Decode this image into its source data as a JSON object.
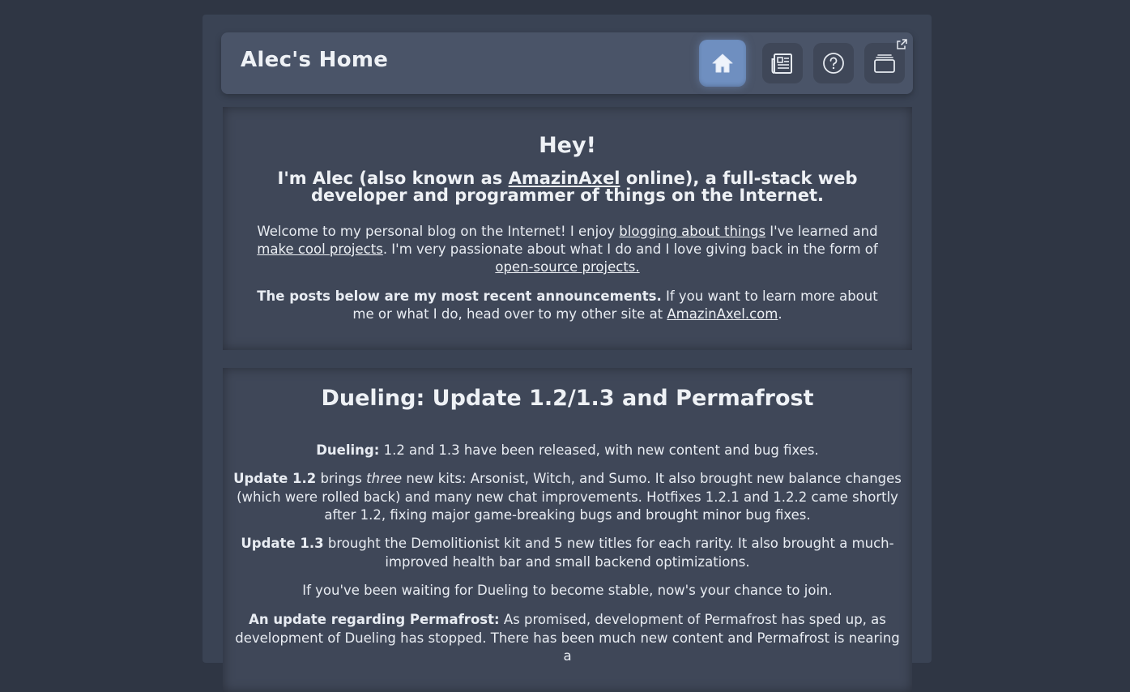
{
  "header": {
    "title": "Alec's Home",
    "nav": [
      {
        "icon": "home-icon",
        "active": true
      },
      {
        "icon": "newspaper-icon",
        "active": false
      },
      {
        "icon": "help-icon",
        "active": false
      },
      {
        "icon": "cards-external-icon",
        "active": false
      }
    ]
  },
  "intro": {
    "heading": "Hey!",
    "tagline_pre": "I'm Alec (also known as ",
    "tagline_link": "AmazinAxel",
    "tagline_post": " online), a full-stack web developer and programmer of things on the Internet.",
    "p1_a": "Welcome to my personal blog on the Internet! I enjoy ",
    "p1_link1": "blogging about things",
    "p1_b": " I've learned and ",
    "p1_link2": "make cool projects",
    "p1_c": ". I'm very passionate about what I do and I love giving back in the form of ",
    "p1_link3": "open-source projects.",
    "p2_bold": "The posts below are my most recent announcements.",
    "p2_a": " If you want to learn more about me or what I do, head over to my other site at ",
    "p2_link": "AmazinAxel.com",
    "p2_b": "."
  },
  "post": {
    "title": "Dueling: Update 1.2/1.3 and Permafrost",
    "s1_bold": "Dueling:",
    "s1_text": " 1.2 and 1.3 have been released, with new content and bug fixes.",
    "s2_bold": "Update 1.2",
    "s2_a": " brings ",
    "s2_em": "three",
    "s2_b": " new kits: Arsonist, Witch, and Sumo. It also brought new balance changes (which were rolled back) and many new chat improvements. Hotfixes 1.2.1 and 1.2.2 came shortly after 1.2, fixing major game-breaking bugs and brought minor bug fixes.",
    "s3_bold": "Update 1.3",
    "s3_text": " brought the Demolitionist kit and 5 new titles for each rarity. It also brought a much-improved health bar and small backend optimizations.",
    "s4_text": "If you've been waiting for Dueling to become stable, now's your chance to join.",
    "s5_bold": "An update regarding Permafrost:",
    "s5_text": " As promised, development of Permafrost has sped up, as development of Dueling has stopped. There has been much new content and Permafrost is nearing a"
  },
  "colors": {
    "background": "#2f3644",
    "panel": "#3a4354",
    "header": "#4a5468",
    "active_nav": "#6f8fc0"
  }
}
